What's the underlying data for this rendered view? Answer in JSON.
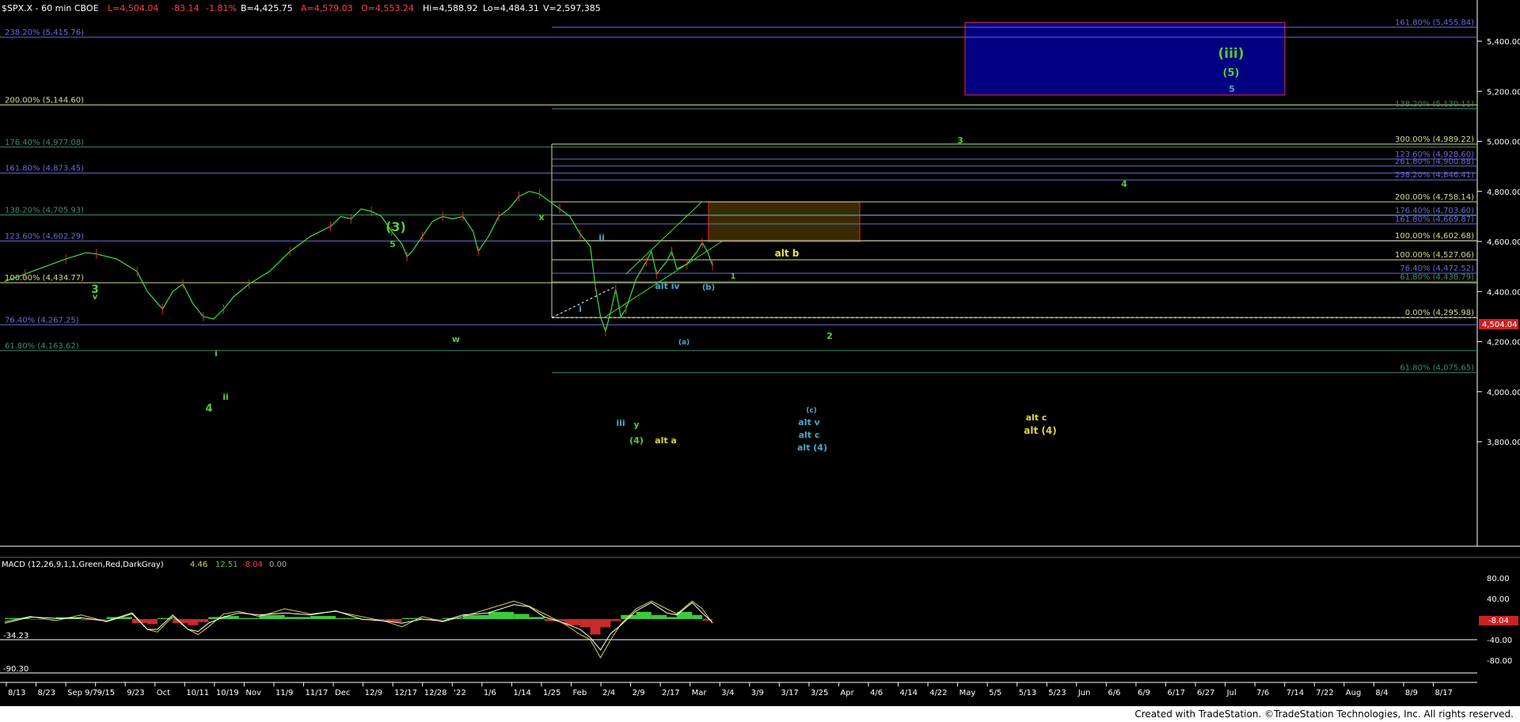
{
  "header": {
    "symbol": "$SPX.X - 60 min  CBOE",
    "last": "L=4,504.04",
    "change": "-83.14",
    "change_pct": "-1.81%",
    "bid": "B=4,425.75",
    "ask": "A=4,579.03",
    "open": "O=4,553.24",
    "hi": "Hi=4,588.92",
    "lo": "Lo=4,484.31",
    "volume": "V=2,597,385"
  },
  "macd": {
    "label": "MACD (12,26,9,1,1,Green,Red,DarkGray)",
    "v1": "4.46",
    "v2": "12.51",
    "v3": "-8.04",
    "v4": "0.00",
    "level_pos": "-34.23",
    "level_neg": "-90.30",
    "current_box": "-8.04"
  },
  "price_box": "4,504.04",
  "footer": "Created with TradeStation. ©TradeStation Technologies, Inc. All rights reserved.",
  "chart_data": {
    "type": "line",
    "title": "$SPX.X - 60 min",
    "ylim": [
      3700,
      5560
    ],
    "y_ticks": [
      "5,400.00",
      "5,200.00",
      "5,000.00",
      "4,800.00",
      "4,600.00",
      "4,400.00",
      "4,200.00",
      "4,000.00",
      "3,800.00"
    ],
    "x_ticks": [
      "8/13",
      "8/23",
      "Sep 9/7",
      "9/15",
      "9/23",
      "Oct",
      "10/11",
      "10/19",
      "Nov",
      "11/9",
      "11/17",
      "Dec",
      "12/9",
      "12/17",
      "12/28",
      "'22",
      "1/6",
      "1/14",
      "1/25",
      "Feb",
      "2/4",
      "2/9",
      "2/17",
      "Mar",
      "3/4",
      "3/9",
      "3/17",
      "3/25",
      "Apr",
      "4/6",
      "4/14",
      "4/22",
      "May",
      "5/5",
      "5/13",
      "5/23",
      "Jun",
      "6/6",
      "6/9",
      "6/17",
      "6/27",
      "Jul",
      "7/6",
      "7/14",
      "7/22",
      "Aug",
      "8/4",
      "8/9",
      "8/17"
    ],
    "price_series": [
      [
        0,
        4440
      ],
      [
        4,
        4470
      ],
      [
        8,
        4500
      ],
      [
        12,
        4530
      ],
      [
        16,
        4555
      ],
      [
        18,
        4550
      ],
      [
        22,
        4530
      ],
      [
        26,
        4480
      ],
      [
        28,
        4400
      ],
      [
        31,
        4330
      ],
      [
        33,
        4400
      ],
      [
        35,
        4430
      ],
      [
        37,
        4350
      ],
      [
        39,
        4300
      ],
      [
        41,
        4290
      ],
      [
        43,
        4330
      ],
      [
        45,
        4380
      ],
      [
        48,
        4430
      ],
      [
        52,
        4480
      ],
      [
        56,
        4560
      ],
      [
        60,
        4620
      ],
      [
        64,
        4660
      ],
      [
        66,
        4700
      ],
      [
        68,
        4690
      ],
      [
        70,
        4730
      ],
      [
        72,
        4720
      ],
      [
        74,
        4700
      ],
      [
        76,
        4640
      ],
      [
        78,
        4590
      ],
      [
        79,
        4540
      ],
      [
        80,
        4560
      ],
      [
        82,
        4620
      ],
      [
        84,
        4680
      ],
      [
        86,
        4700
      ],
      [
        88,
        4690
      ],
      [
        90,
        4700
      ],
      [
        92,
        4640
      ],
      [
        93,
        4560
      ],
      [
        95,
        4620
      ],
      [
        97,
        4700
      ],
      [
        99,
        4730
      ],
      [
        101,
        4780
      ],
      [
        103,
        4800
      ],
      [
        105,
        4790
      ],
      [
        107,
        4760
      ],
      [
        109,
        4730
      ],
      [
        111,
        4700
      ],
      [
        113,
        4630
      ],
      [
        115,
        4580
      ],
      [
        116,
        4420
      ],
      [
        117,
        4300
      ],
      [
        118,
        4240
      ],
      [
        119,
        4320
      ],
      [
        120,
        4410
      ],
      [
        121,
        4300
      ],
      [
        122,
        4330
      ],
      [
        124,
        4450
      ],
      [
        126,
        4520
      ],
      [
        127,
        4560
      ],
      [
        128,
        4470
      ],
      [
        130,
        4520
      ],
      [
        131,
        4560
      ],
      [
        132,
        4490
      ],
      [
        134,
        4510
      ],
      [
        136,
        4560
      ],
      [
        137,
        4595
      ],
      [
        138,
        4560
      ],
      [
        139,
        4504
      ]
    ],
    "macd_series": [
      [
        0,
        -5
      ],
      [
        5,
        5
      ],
      [
        10,
        -3
      ],
      [
        15,
        8
      ],
      [
        20,
        -5
      ],
      [
        25,
        10
      ],
      [
        28,
        -20
      ],
      [
        30,
        -25
      ],
      [
        33,
        5
      ],
      [
        36,
        -20
      ],
      [
        38,
        -30
      ],
      [
        40,
        -15
      ],
      [
        43,
        10
      ],
      [
        46,
        15
      ],
      [
        50,
        5
      ],
      [
        55,
        20
      ],
      [
        60,
        10
      ],
      [
        65,
        15
      ],
      [
        70,
        5
      ],
      [
        75,
        -5
      ],
      [
        78,
        -15
      ],
      [
        82,
        5
      ],
      [
        86,
        -5
      ],
      [
        90,
        5
      ],
      [
        95,
        20
      ],
      [
        100,
        35
      ],
      [
        103,
        25
      ],
      [
        106,
        10
      ],
      [
        110,
        -10
      ],
      [
        113,
        -30
      ],
      [
        115,
        -40
      ],
      [
        117,
        -75
      ],
      [
        119,
        -40
      ],
      [
        121,
        -10
      ],
      [
        124,
        20
      ],
      [
        127,
        35
      ],
      [
        130,
        20
      ],
      [
        132,
        10
      ],
      [
        135,
        35
      ],
      [
        137,
        20
      ],
      [
        139,
        -8
      ]
    ],
    "fib_levels": [
      {
        "label": "161.80% (5,455.84)",
        "value": 5456,
        "color": "#6a6ad8"
      },
      {
        "label": "238.20% (5,415.76)",
        "value": 5416,
        "color": "#6a6ad8"
      },
      {
        "label": "200.00% (5,144.60)",
        "value": 5145,
        "color": "#d8d890"
      },
      {
        "label": "138.20% (5,130.11)",
        "value": 5130,
        "color": "#3c8c6c"
      },
      {
        "label": "176.40% (4,977.08)",
        "value": 4977,
        "color": "#3c8c6c"
      },
      {
        "label": "300.00% (4,989.22)",
        "value": 4989,
        "color": "#d8d890"
      },
      {
        "label": "123.60% (4,928.60)",
        "value": 4929,
        "color": "#6a6ad8"
      },
      {
        "label": "161.80% (4,873.45)",
        "value": 4873,
        "color": "#6a6ad8"
      },
      {
        "label": "261.80% (4,900.88)",
        "value": 4901,
        "color": "#6a6ad8"
      },
      {
        "label": "238.20% (4,846.41)",
        "value": 4846,
        "color": "#6a6ad8"
      },
      {
        "label": "200.00% (4,758.14)",
        "value": 4758,
        "color": "#d8d890"
      },
      {
        "label": "138.20% (4,705.93)",
        "value": 4706,
        "color": "#3c8c6c"
      },
      {
        "label": "176.40% (4,703.60)",
        "value": 4704,
        "color": "#6a6ad8"
      },
      {
        "label": "161.80% (4,669.87)",
        "value": 4670,
        "color": "#6a6ad8"
      },
      {
        "label": "123.60% (4,602.29)",
        "value": 4602,
        "color": "#6a6ad8"
      },
      {
        "label": "100.00% (4,602.68)",
        "value": 4603,
        "color": "#d8d890"
      },
      {
        "label": "100.00% (4,527.06)",
        "value": 4527,
        "color": "#d8d890"
      },
      {
        "label": "76.40% (4,472.52)",
        "value": 4473,
        "color": "#6a6ad8"
      },
      {
        "label": "61.80% (4,438.79)",
        "value": 4439,
        "color": "#3c8c6c"
      },
      {
        "label": "100.00% (4,434.77)",
        "value": 4435,
        "color": "#d8d890"
      },
      {
        "label": "0.00% (4,295.98)",
        "value": 4296,
        "color": "#d8d890"
      },
      {
        "label": "76.40% (4,267.25)",
        "value": 4267,
        "color": "#6a6ad8"
      },
      {
        "label": "61.80% (4,163.62)",
        "value": 4164,
        "color": "#3c8c6c"
      },
      {
        "label": "61.80% (4,075.65)",
        "value": 4076,
        "color": "#3c8c6c"
      }
    ],
    "wave_labels": [
      {
        "text": "3",
        "color": "#55cc33"
      },
      {
        "text": "v",
        "color": "#55cc33"
      },
      {
        "text": "(3)",
        "color": "#55cc33"
      },
      {
        "text": "5",
        "color": "#55cc33"
      },
      {
        "text": "x",
        "color": "#55cc33"
      },
      {
        "text": "w",
        "color": "#55cc33"
      },
      {
        "text": "i",
        "color": "#55cc33"
      },
      {
        "text": "ii",
        "color": "#55cc33"
      },
      {
        "text": "4",
        "color": "#55cc33"
      },
      {
        "text": "ii",
        "color": "#4aa8c8"
      },
      {
        "text": "i",
        "color": "#4aa8c8"
      },
      {
        "text": "iii",
        "color": "#4aa8c8"
      },
      {
        "text": "y",
        "color": "#55cc33"
      },
      {
        "text": "(4)",
        "color": "#55cc33"
      },
      {
        "text": "alt a",
        "color": "#d8d840"
      },
      {
        "text": "alt iv",
        "color": "#4aa8c8"
      },
      {
        "text": "(b)",
        "color": "#4aa8c8"
      },
      {
        "text": "(a)",
        "color": "#4aa8c8"
      },
      {
        "text": "1",
        "color": "#55cc33"
      },
      {
        "text": "2",
        "color": "#55cc33"
      },
      {
        "text": "alt b",
        "color": "#e8e840"
      },
      {
        "text": "(c)",
        "color": "#4aa8c8"
      },
      {
        "text": "alt v",
        "color": "#4aa8c8"
      },
      {
        "text": "alt c",
        "color": "#4aa8c8"
      },
      {
        "text": "alt (4)",
        "color": "#4aa8c8"
      },
      {
        "text": "3",
        "color": "#55cc33"
      },
      {
        "text": "4",
        "color": "#55cc33"
      },
      {
        "text": "alt c",
        "color": "#d8d840"
      },
      {
        "text": "alt (4)",
        "color": "#d8d840"
      },
      {
        "text": "(iii)",
        "color": "#55cc33"
      },
      {
        "text": "(5)",
        "color": "#55cc33"
      },
      {
        "text": "5",
        "color": "#4aa8c8"
      }
    ],
    "target_box": {
      "low": 5185,
      "high": 5475,
      "color": "#000080"
    },
    "alt_b_box": {
      "low": 4600,
      "high": 4758,
      "color": "#3a2a00"
    }
  }
}
